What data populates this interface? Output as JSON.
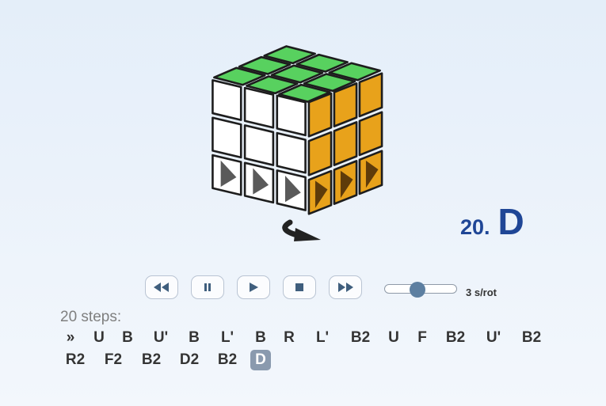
{
  "current_step": {
    "number": "20.",
    "move": "D"
  },
  "controls": {
    "buttons": [
      {
        "name": "rewind-button",
        "icon": "rewind-icon"
      },
      {
        "name": "pause-button",
        "icon": "pause-icon"
      },
      {
        "name": "play-button",
        "icon": "play-icon"
      },
      {
        "name": "stop-button",
        "icon": "stop-icon"
      },
      {
        "name": "fast-forward-button",
        "icon": "fast-forward-icon"
      }
    ],
    "speed": {
      "label": "3 s/rot",
      "slider_fraction": 0.45
    }
  },
  "sequence": {
    "count_label": "20 steps:",
    "start_marker": "»",
    "moves": [
      "U",
      "B",
      "U'",
      "B",
      "L'",
      "B",
      "R",
      "L'",
      "B2",
      "U",
      "F",
      "B2",
      "U'",
      "B2",
      "R2",
      "F2",
      "B2",
      "D2",
      "B2",
      "D"
    ],
    "current_index": 19
  },
  "cube": {
    "top_color": "#58d15f",
    "front_color": "#ffffff",
    "right_color": "#e8a21b",
    "front_bottom_row_arrows": 3,
    "right_bottom_row_arrows": 3,
    "rotation_arrow_icon": "rotate-arrow-icon"
  }
}
